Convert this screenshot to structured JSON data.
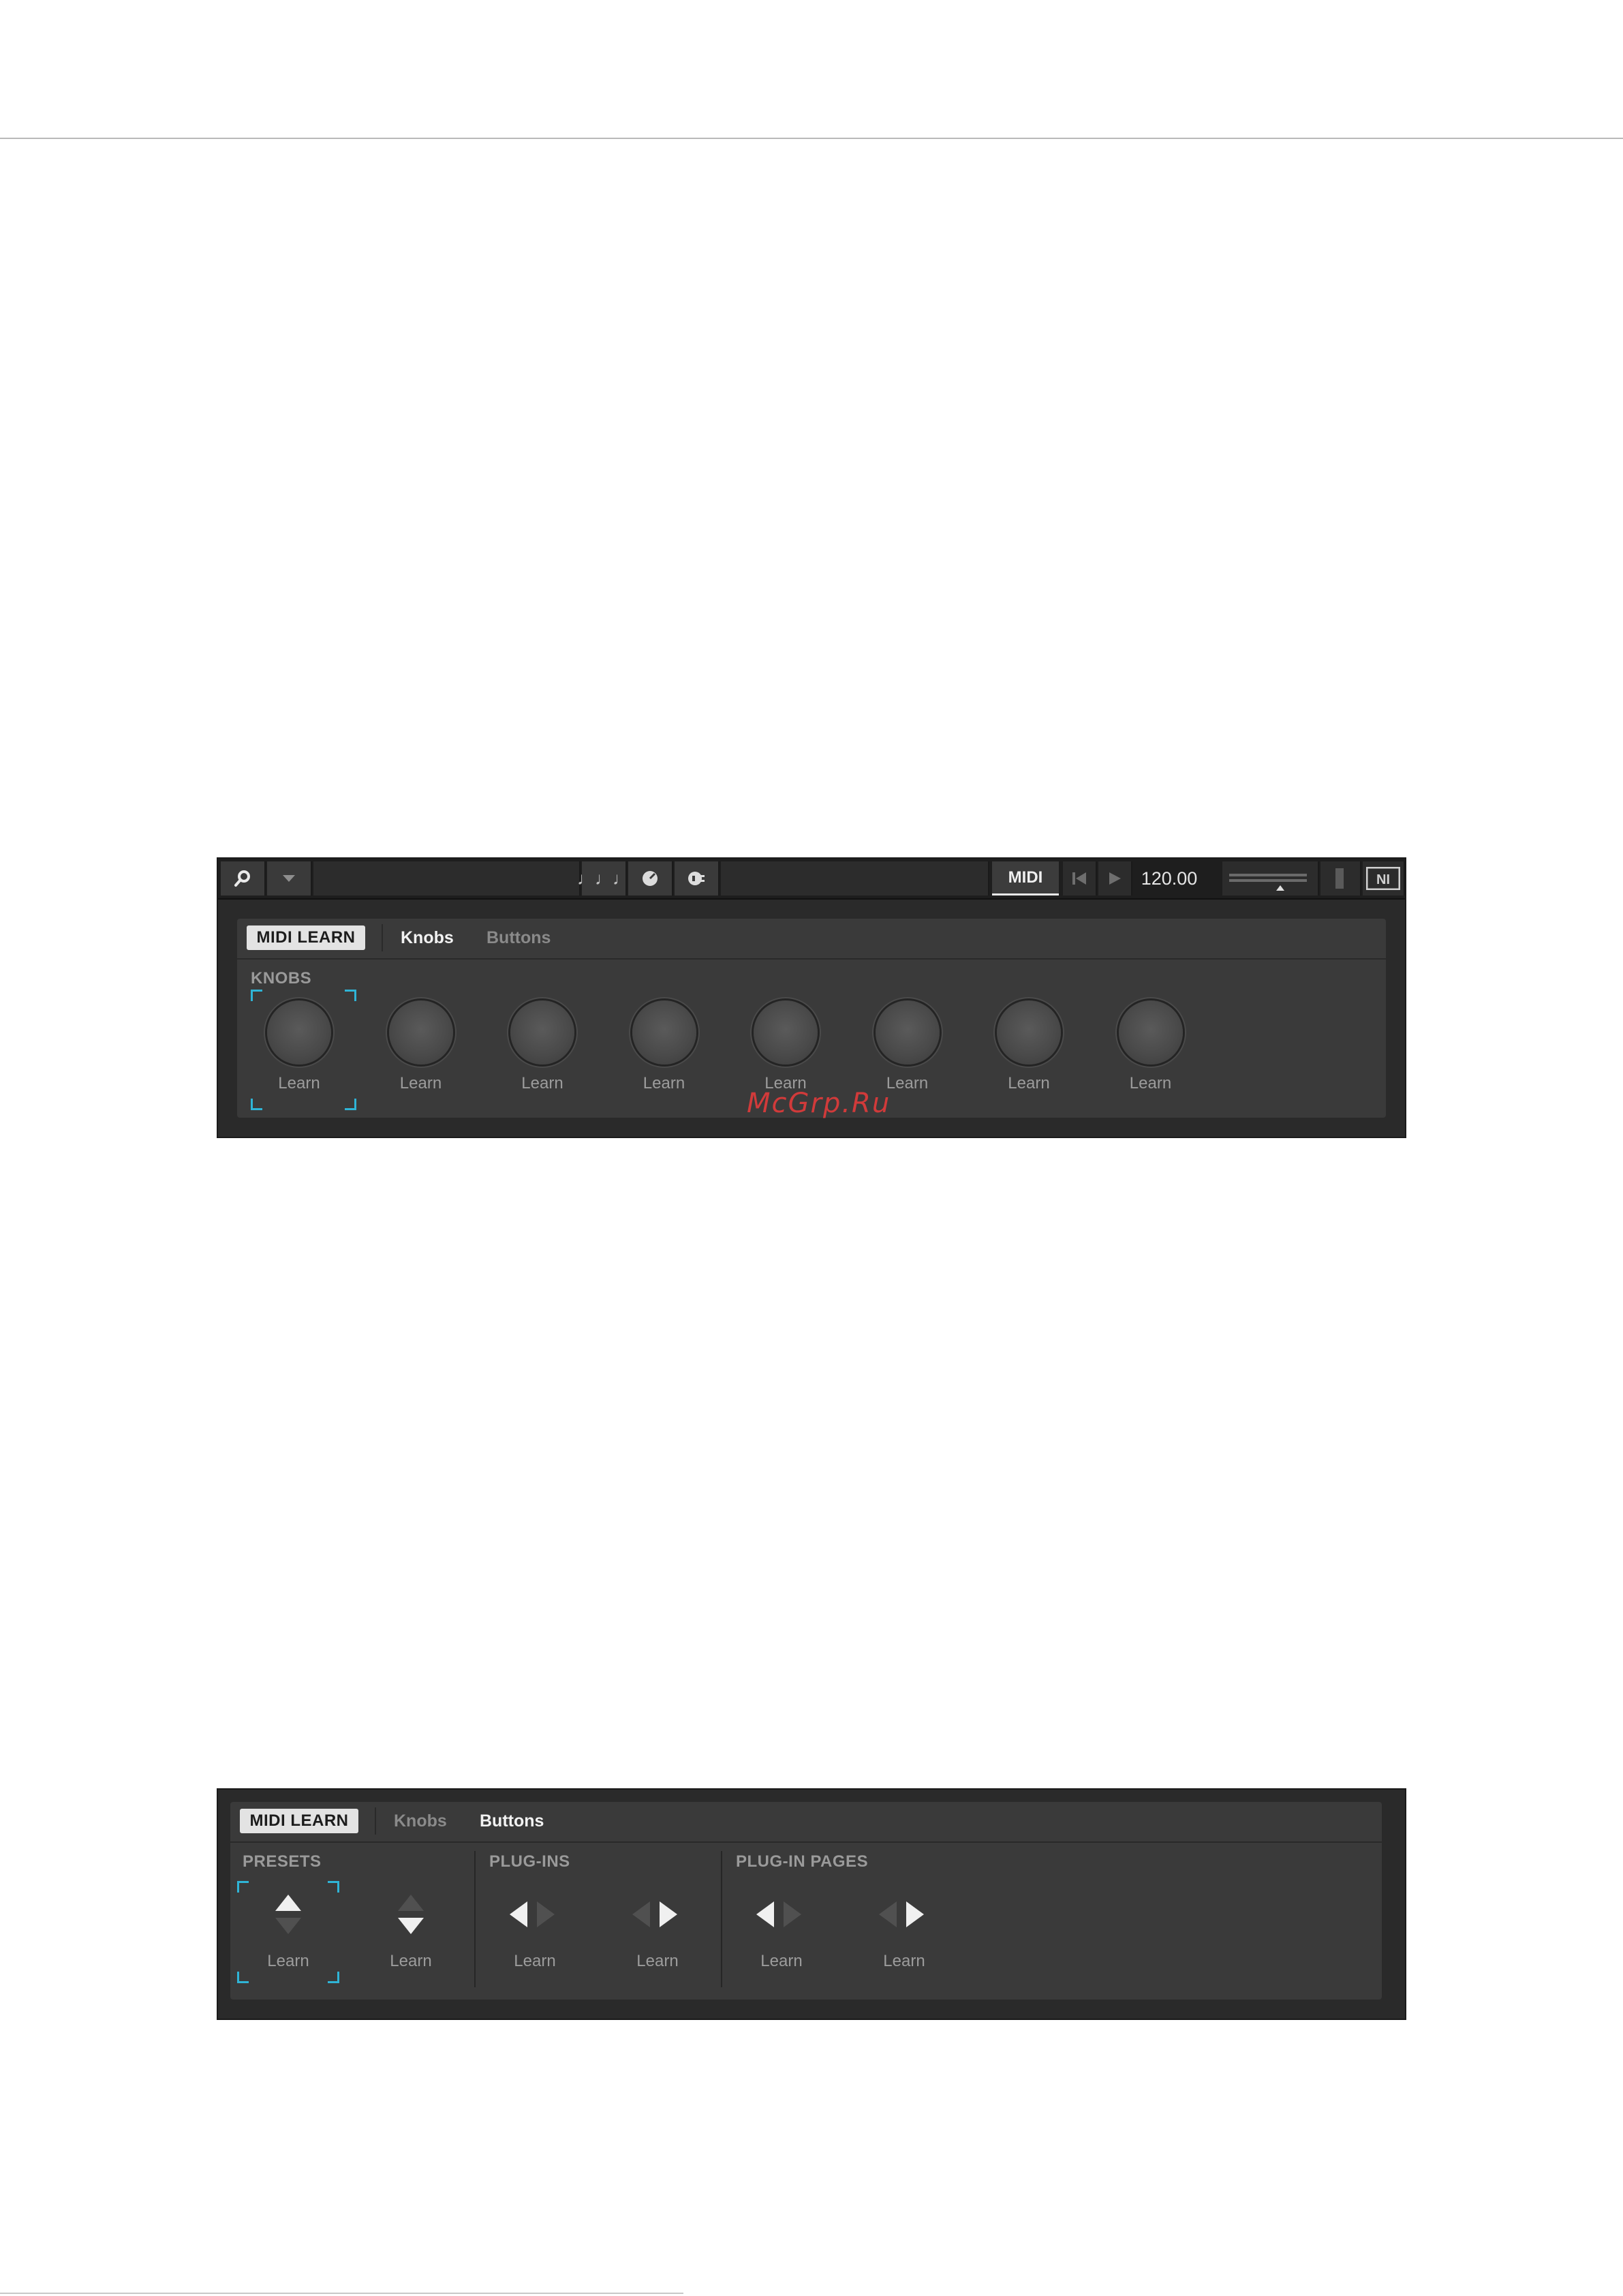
{
  "watermark": "McGrp.Ru",
  "shot1": {
    "toolbar": {
      "search_icon": "search-icon",
      "dropdown_icon": "chevron-down-icon",
      "notes_icon": "music-notes-icon",
      "notes_glyph": "♩♩♩",
      "knob_icon": "knob-icon",
      "plugin_icon": "plugin-icon",
      "midi_label": "MIDI",
      "tempo": "120.00",
      "ni_logo": "NI"
    },
    "tabs": {
      "midi_learn": "MIDI LEARN",
      "knobs": "Knobs",
      "buttons": "Buttons",
      "active": "Knobs"
    },
    "section": "KNOBS",
    "knobs": [
      {
        "label": "Learn",
        "selected": true
      },
      {
        "label": "Learn",
        "selected": false
      },
      {
        "label": "Learn",
        "selected": false
      },
      {
        "label": "Learn",
        "selected": false
      },
      {
        "label": "Learn",
        "selected": false
      },
      {
        "label": "Learn",
        "selected": false
      },
      {
        "label": "Learn",
        "selected": false
      },
      {
        "label": "Learn",
        "selected": false
      }
    ]
  },
  "shot2": {
    "tabs": {
      "midi_learn": "MIDI LEARN",
      "knobs": "Knobs",
      "buttons": "Buttons",
      "active": "Buttons"
    },
    "groups": {
      "presets": {
        "label": "PRESETS",
        "buttons": [
          {
            "label": "Learn",
            "icon": "arrow-up-icon",
            "selected": true
          },
          {
            "label": "Learn",
            "icon": "arrow-down-icon",
            "selected": false
          }
        ]
      },
      "plugins": {
        "label": "PLUG-INS",
        "buttons": [
          {
            "label": "Learn",
            "icon": "arrow-left-icon"
          },
          {
            "label": "Learn",
            "icon": "arrow-right-icon"
          }
        ]
      },
      "plugin_pages": {
        "label": "PLUG-IN PAGES",
        "buttons": [
          {
            "label": "Learn",
            "icon": "arrow-left-icon"
          },
          {
            "label": "Learn",
            "icon": "arrow-right-icon"
          }
        ]
      }
    }
  },
  "colors": {
    "background": "#2a2a2a",
    "panel": "#3a3a3a",
    "selection_corner": "#2fb4d6",
    "watermark": "#d13a3a"
  }
}
